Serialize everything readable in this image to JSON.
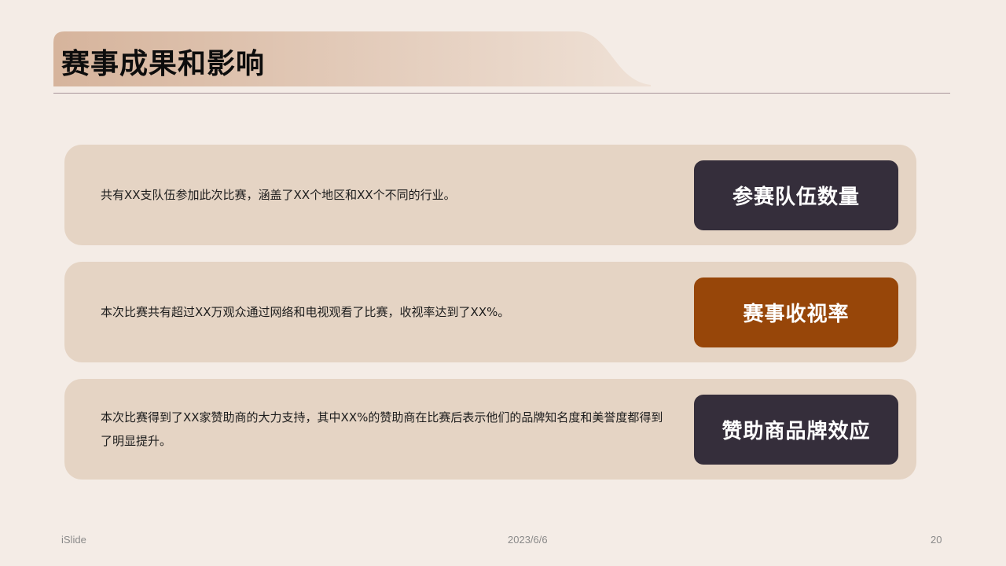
{
  "slide": {
    "title": "赛事成果和影响",
    "cards": [
      {
        "text": "共有XX支队伍参加此次比赛，涵盖了XX个地区和XX个不同的行业。",
        "badge": "参赛队伍数量",
        "badge_color": "#352e3b"
      },
      {
        "text": "本次比赛共有超过XX万观众通过网络和电视观看了比赛，收视率达到了XX%。",
        "badge": "赛事收视率",
        "badge_color": "#974609"
      },
      {
        "text": "本次比赛得到了XX家赞助商的大力支持，其中XX%的赞助商在比赛后表示他们的品牌知名度和美誉度都得到了明显提升。",
        "badge": "赞助商品牌效应",
        "badge_color": "#352e3b"
      }
    ]
  },
  "footer": {
    "left": "iSlide",
    "center": "2023/6/6",
    "right": "20"
  },
  "colors": {
    "background": "#f4ece6",
    "card": "#e5d4c4",
    "title_band_start": "#d6b49c",
    "title_band_end": "#efe1d6"
  }
}
